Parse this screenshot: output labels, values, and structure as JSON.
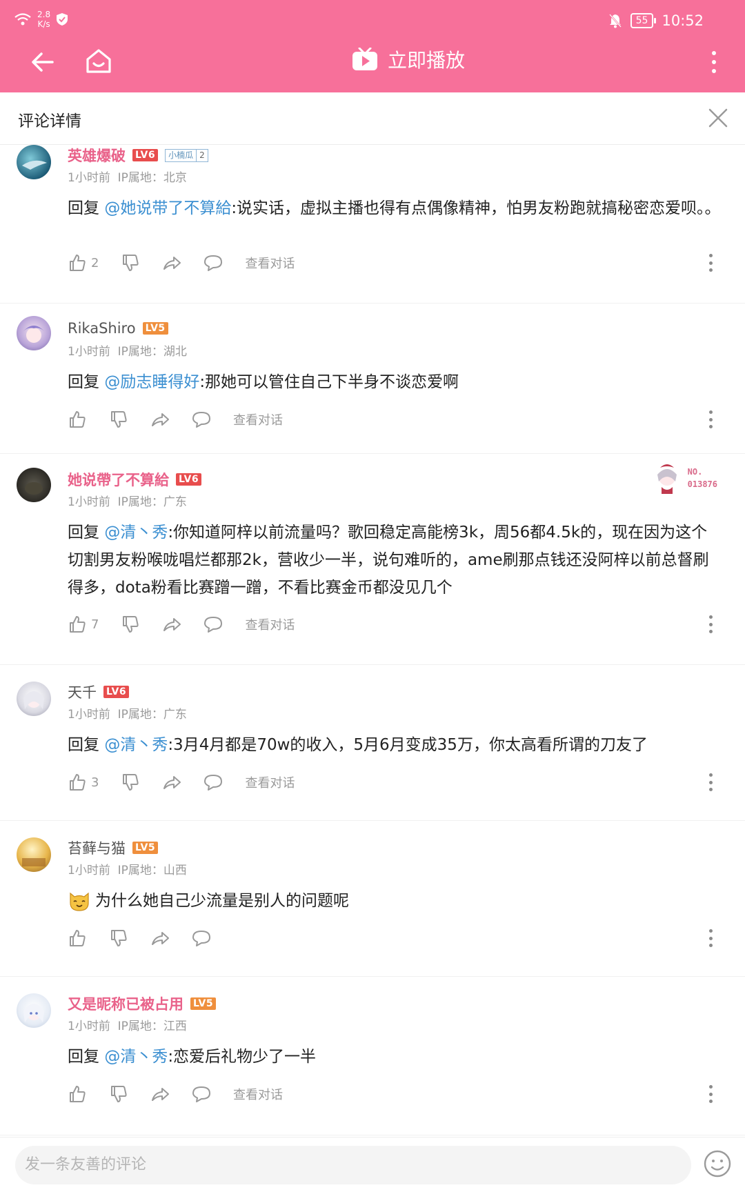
{
  "status_bar": {
    "net_speed": "2.8",
    "net_unit": "K/s",
    "battery": "55",
    "time": "10:52"
  },
  "appbar": {
    "play_label": "立即播放"
  },
  "sheet": {
    "title": "评论详情"
  },
  "actions": {
    "view_dialog": "查看对话"
  },
  "comments": [
    {
      "username": "英雄爆破",
      "level": "LV6",
      "fan_badge": "小楠瓜",
      "fan_level": "2",
      "time": "1小时前",
      "ip": "IP属地：北京",
      "reply_prefix": "回复 ",
      "reply_to": "@她说带了不算給",
      "text": ":说实话，虚拟主播也得有点偶像精神，怕男友粉跑就搞秘密恋爱呗。。",
      "likes": "2"
    },
    {
      "username": "RikaShiro",
      "level": "LV5",
      "time": "1小时前",
      "ip": "IP属地：湖北",
      "reply_prefix": "回复 ",
      "reply_to": "@励志睡得好",
      "text": ":那她可以管住自己下半身不谈恋爱啊",
      "likes": ""
    },
    {
      "username": "她说帶了不算給",
      "level": "LV6",
      "medal_no": "NO.",
      "medal_num": "013876",
      "time": "1小时前",
      "ip": "IP属地：广东",
      "reply_prefix": "回复 ",
      "reply_to": "@清丶秀",
      "text": ":你知道阿梓以前流量吗？歌回稳定高能榜3k，周56都4.5k的，现在因为这个切割男友粉喉咙唱烂都那2k，营收少一半，说句难听的，ame刷那点钱还没阿梓以前总督刷得多，dota粉看比赛蹭一蹭，不看比赛金币都没见几个",
      "likes": "7"
    },
    {
      "username": "天千",
      "level": "LV6",
      "time": "1小时前",
      "ip": "IP属地：广东",
      "reply_prefix": "回复 ",
      "reply_to": "@清丶秀",
      "text": ":3月4月都是70w的收入，5月6月变成35万，你太高看所谓的刀友了",
      "likes": "3"
    },
    {
      "username": "苔藓与猫",
      "level": "LV5",
      "time": "1小时前",
      "ip": "IP属地：山西",
      "text": "为什么她自己少流量是别人的问题呢",
      "likes": ""
    },
    {
      "username": "又是昵称已被占用",
      "level": "LV5",
      "time": "1小时前",
      "ip": "IP属地：江西",
      "reply_prefix": "回复 ",
      "reply_to": "@清丶秀",
      "text": ":恋爱后礼物少了一半",
      "likes": ""
    }
  ],
  "composer": {
    "placeholder": "发一条友善的评论"
  },
  "colors": {
    "brand_pink": "#f7709a",
    "mention_blue": "#3b8fd1",
    "name_pink": "#e9628a"
  }
}
